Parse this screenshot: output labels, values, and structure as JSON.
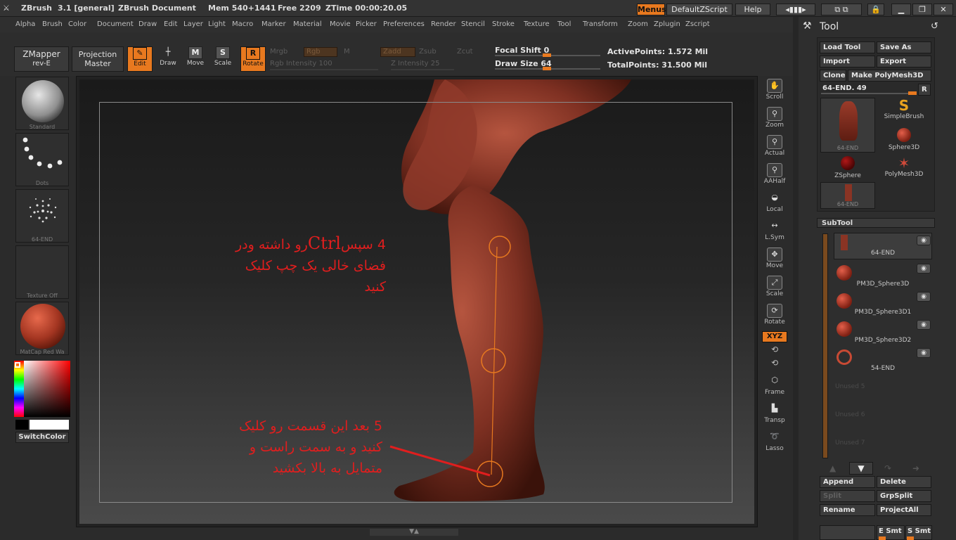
{
  "titlebar": {
    "app": "ZBrush",
    "version": "3.1 [general]",
    "document": "ZBrush Document",
    "mem": "Mem 540+1441",
    "free": "Free 2209",
    "ztime": "ZTime 00:00:20.05",
    "menus_label": "Menus",
    "script_label": "DefaultZScript",
    "help_label": "Help"
  },
  "menu": [
    "Alpha",
    "Brush",
    "Color",
    "Document",
    "Draw",
    "Edit",
    "Layer",
    "Light",
    "Macro",
    "Marker",
    "Material",
    "Movie",
    "Picker",
    "Preferences",
    "Render",
    "Stencil",
    "Stroke",
    "Texture",
    "Tool",
    "Transform",
    "Zoom",
    "Zplugin",
    "Zscript"
  ],
  "toolbar": {
    "zmapper_line1": "ZMapper",
    "zmapper_line2": "rev-E",
    "projection_line1": "Projection",
    "projection_line2": "Master",
    "edit": "Edit",
    "draw": "Draw",
    "move": "Move",
    "scale": "Scale",
    "rotate": "Rotate",
    "mrgb": "Mrgb",
    "rgb": "Rgb",
    "m": "M",
    "zadd": "Zadd",
    "zsub": "Zsub",
    "zcut": "Zcut",
    "rgb_intensity": "Rgb Intensity 100",
    "z_intensity": "Z Intensity 25",
    "focal_shift": "Focal Shift 0",
    "draw_size": "Draw Size 64",
    "active_points": "ActivePoints: 1.572 Mil",
    "total_points": "TotalPoints: 31.500 Mil"
  },
  "leftshelf": {
    "brush": "Standard",
    "stroke": "Dots",
    "alpha": "64-END",
    "texture": "Texture Off",
    "material": "MatCap Red Wa",
    "switch_color": "SwitchColor"
  },
  "rightshelf": [
    "Scroll",
    "Zoom",
    "Actual",
    "AAHalf",
    "Local",
    "L.Sym",
    "Move",
    "Scale",
    "Rotate",
    "XYZ",
    "Frame",
    "Transp",
    "Lasso"
  ],
  "annotations": {
    "step4_num": "4",
    "step4_line1": "سپس",
    "step4_ctrl": "Ctrl",
    "step4_line1b": "رو داشته ودر",
    "step4_line2": "فضای خالی یک چپ کلیک",
    "step4_line3": "کنید",
    "step5_num": "5",
    "step5_line1": "بعد این قسمت رو کلیک",
    "step5_line2": "کنید و به سمت راست و",
    "step5_line3": "متمایل به بالا بکشید"
  },
  "toolpanel": {
    "title": "Tool",
    "load_tool": "Load Tool",
    "save_as": "Save As",
    "import": "Import",
    "export": "Export",
    "clone": "Clone",
    "make_polymesh": "Make PolyMesh3D",
    "slider_label": "64-END. 49",
    "r": "R",
    "tools": [
      "64-END",
      "SimpleBrush",
      "Sphere3D",
      "ZSphere",
      "PolyMesh3D",
      "64-END"
    ],
    "subtool_title": "SubTool",
    "subtools": [
      "64-END",
      "PM3D_Sphere3D",
      "PM3D_Sphere3D1",
      "PM3D_Sphere3D2",
      "54-END",
      "Unused 5",
      "Unused 6",
      "Unused 7"
    ],
    "append": "Append",
    "delete": "Delete",
    "split": "Split",
    "grpsplit": "GrpSplit",
    "rename": "Rename",
    "projectall": "ProjectAll",
    "esmt": "E Smt",
    "ssmt": "S Smt"
  },
  "colors": {
    "accent": "#e8791f",
    "annotation": "#e01e1e",
    "model": "#8b3a2c"
  }
}
